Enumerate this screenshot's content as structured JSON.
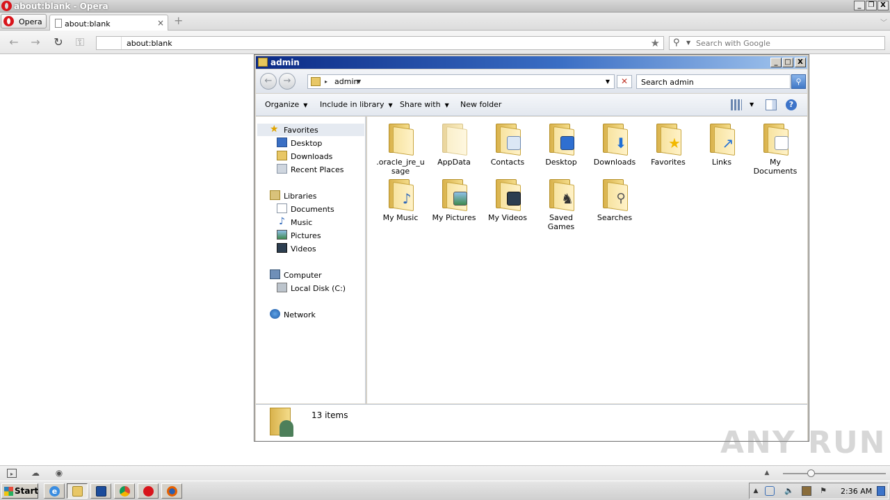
{
  "browser": {
    "window_title": "about:blank - Opera",
    "menu_label": "Opera",
    "tab_label": "about:blank",
    "tab_close": "×",
    "new_tab": "+",
    "url": "about:blank",
    "search_placeholder": "Search with Google",
    "window_controls": [
      "_",
      "❐",
      "X"
    ]
  },
  "explorer": {
    "title": "admin",
    "breadcrumb": "admin",
    "search_placeholder": "Search admin",
    "commands": [
      "Organize",
      "Include in library",
      "Share with",
      "New folder"
    ],
    "window_controls": [
      "_",
      "□",
      "X"
    ],
    "nav": {
      "favorites": {
        "label": "Favorites",
        "items": [
          "Desktop",
          "Downloads",
          "Recent Places"
        ]
      },
      "libraries": {
        "label": "Libraries",
        "items": [
          "Documents",
          "Music",
          "Pictures",
          "Videos"
        ]
      },
      "computer": {
        "label": "Computer",
        "items": [
          "Local Disk (C:)"
        ]
      },
      "network": {
        "label": "Network"
      }
    },
    "folders": [
      {
        "name": ".oracle_jre_u\nsage",
        "line1": ".oracle_jre_u",
        "line2": "sage",
        "icon": "folder"
      },
      {
        "name": "AppData",
        "line1": "AppData",
        "line2": "",
        "icon": "folder-hidden"
      },
      {
        "name": "Contacts",
        "line1": "Contacts",
        "line2": "",
        "icon": "folder-contacts"
      },
      {
        "name": "Desktop",
        "line1": "Desktop",
        "line2": "",
        "icon": "folder-desktop"
      },
      {
        "name": "Downloads",
        "line1": "Downloads",
        "line2": "",
        "icon": "folder-downloads"
      },
      {
        "name": "Favorites",
        "line1": "Favorites",
        "line2": "",
        "icon": "folder-favorites"
      },
      {
        "name": "Links",
        "line1": "Links",
        "line2": "",
        "icon": "folder-links"
      },
      {
        "name": "My Documents",
        "line1": "My",
        "line2": "Documents",
        "icon": "folder-documents"
      },
      {
        "name": "My Music",
        "line1": "My Music",
        "line2": "",
        "icon": "folder-music"
      },
      {
        "name": "My Pictures",
        "line1": "My Pictures",
        "line2": "",
        "icon": "folder-pictures"
      },
      {
        "name": "My Videos",
        "line1": "My Videos",
        "line2": "",
        "icon": "folder-videos"
      },
      {
        "name": "Saved Games",
        "line1": "Saved",
        "line2": "Games",
        "icon": "folder-games"
      },
      {
        "name": "Searches",
        "line1": "Searches",
        "line2": "",
        "icon": "folder-searches"
      }
    ],
    "status": "13 items"
  },
  "taskbar": {
    "start_label": "Start",
    "clock": "2:36 AM",
    "apps": [
      "internet-explorer",
      "explorer",
      "media-player",
      "chrome",
      "opera",
      "firefox"
    ]
  },
  "watermark": "ANY RUN",
  "colors": {
    "explorer_title_start": "#0b2a85",
    "folder": "#f4dc8a",
    "opera_red": "#d8141b"
  }
}
